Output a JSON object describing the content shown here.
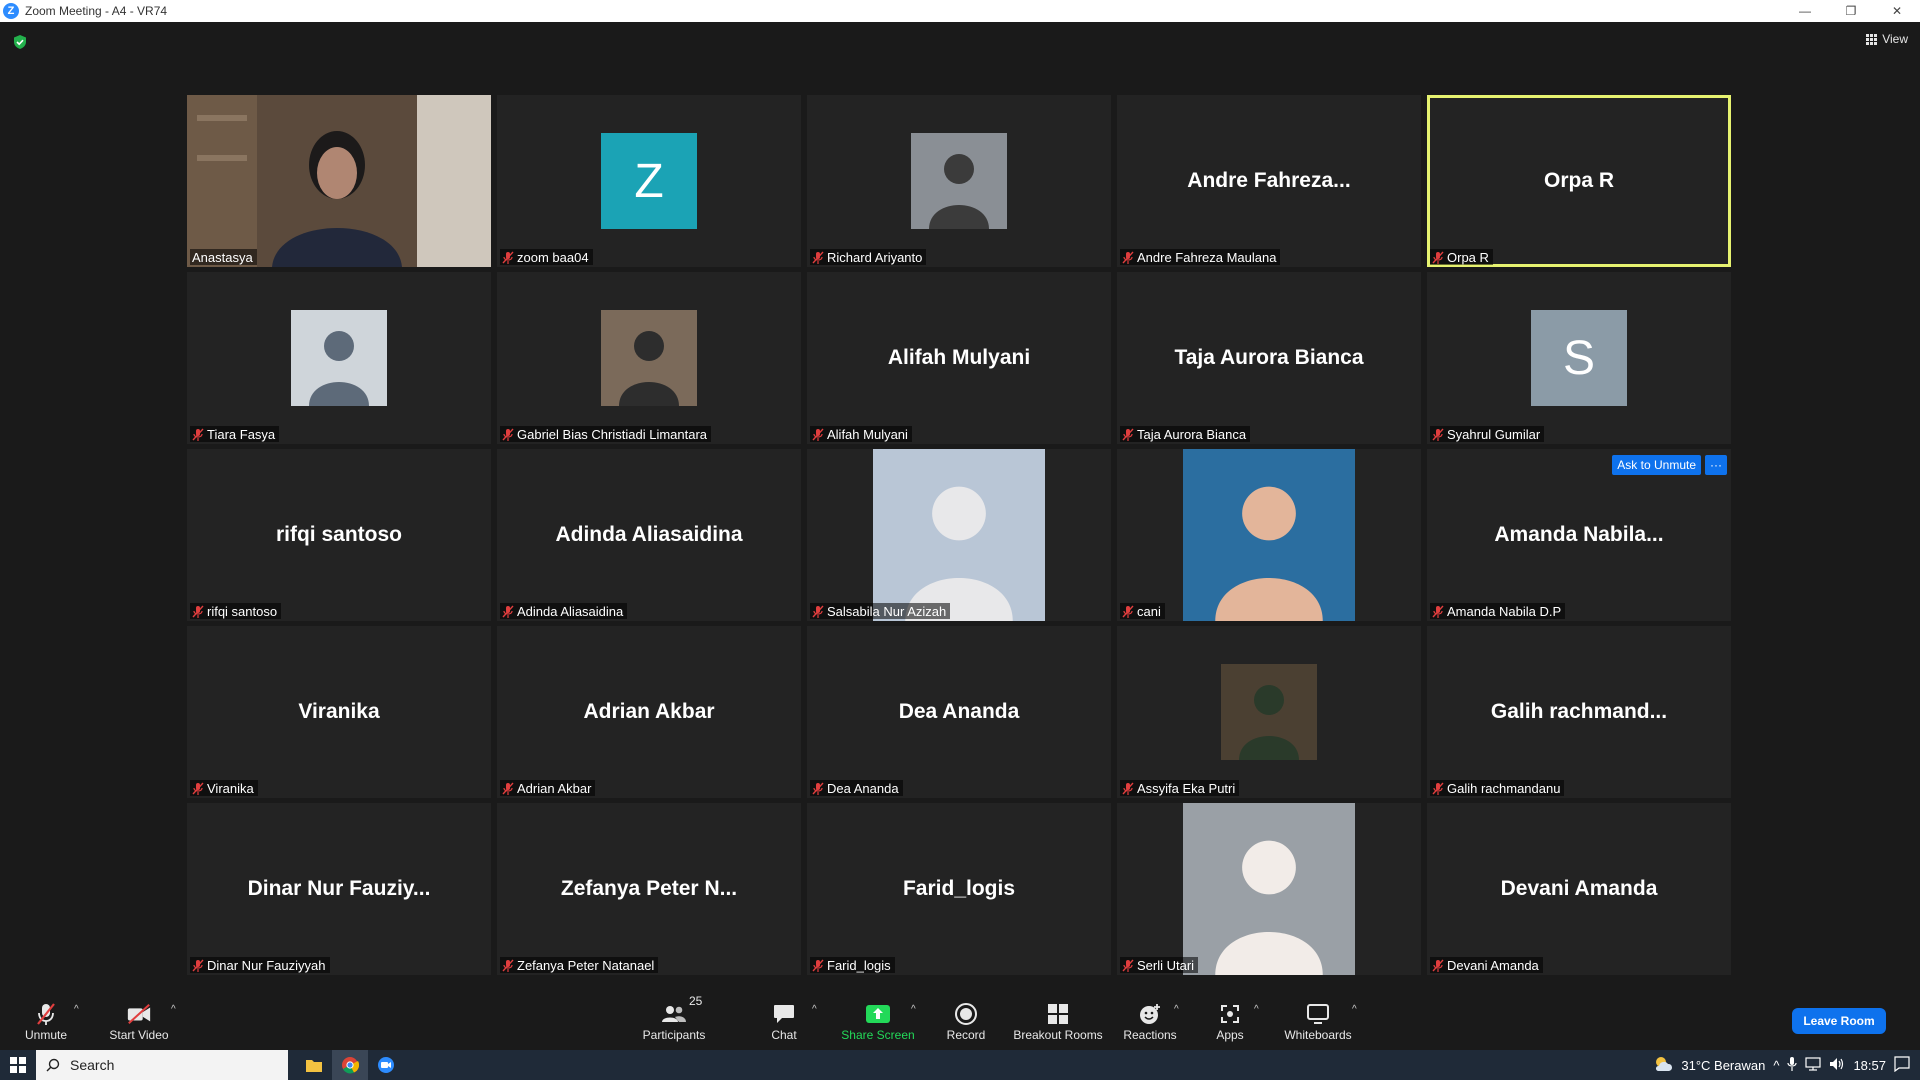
{
  "window": {
    "title": "Zoom Meeting - A4 - VR74",
    "app_logo_letter": "Z"
  },
  "meeting": {
    "view_label": "View",
    "ask_unmute_label": "Ask to Unmute",
    "tile_more_label": "···",
    "active_speaker_color": "#e6f270",
    "participants": [
      {
        "name": "Anastasya",
        "display": "video",
        "muted": false
      },
      {
        "name": "zoom baa04",
        "display": "letter",
        "letter": "Z",
        "color": "#1ba3b5",
        "muted": true
      },
      {
        "name": "Richard Ariyanto",
        "display": "photo",
        "muted": true
      },
      {
        "name": "Andre Fahreza Maulana",
        "display": "text",
        "big": "Andre  Fahreza...",
        "muted": true
      },
      {
        "name": "Orpa R",
        "display": "text",
        "big": "Orpa R",
        "muted": true,
        "active": true
      },
      {
        "name": "Tiara Fasya",
        "display": "photo",
        "muted": true
      },
      {
        "name": "Gabriel Bias Christiadi Limantara",
        "display": "photo",
        "muted": true
      },
      {
        "name": "Alifah Mulyani",
        "display": "text",
        "big": "Alifah Mulyani",
        "muted": true
      },
      {
        "name": "Taja Aurora Bianca",
        "display": "text",
        "big": "Taja Aurora Bianca",
        "muted": true
      },
      {
        "name": "Syahrul Gumilar",
        "display": "letter",
        "letter": "S",
        "color": "#8b9ba7",
        "muted": true
      },
      {
        "name": "rifqi santoso",
        "display": "text",
        "big": "rifqi santoso",
        "muted": true
      },
      {
        "name": "Adinda Aliasaidina",
        "display": "text",
        "big": "Adinda Aliasaidina",
        "muted": true
      },
      {
        "name": "Salsabila Nur Azizah",
        "display": "photo-tall",
        "muted": true
      },
      {
        "name": "cani",
        "display": "photo-tall",
        "muted": true
      },
      {
        "name": "Amanda Nabila D.P",
        "display": "text",
        "big": "Amanda  Nabila...",
        "muted": true,
        "hover": true
      },
      {
        "name": "Viranika",
        "display": "text",
        "big": "Viranika",
        "muted": true
      },
      {
        "name": "Adrian Akbar",
        "display": "text",
        "big": "Adrian Akbar",
        "muted": true
      },
      {
        "name": "Dea Ananda",
        "display": "text",
        "big": "Dea Ananda",
        "muted": true
      },
      {
        "name": "Assyifa Eka Putri",
        "display": "photo",
        "muted": true
      },
      {
        "name": "Galih rachmandanu",
        "display": "text",
        "big": "Galih  rachmand...",
        "muted": true
      },
      {
        "name": "Dinar Nur Fauziyyah",
        "display": "text",
        "big": "Dinar  Nur  Fauziy...",
        "muted": true
      },
      {
        "name": "Zefanya Peter Natanael",
        "display": "text",
        "big": "Zefanya  Peter  N...",
        "muted": true
      },
      {
        "name": "Farid_logis",
        "display": "text",
        "big": "Farid_logis",
        "muted": true
      },
      {
        "name": "Serli Utari",
        "display": "photo-tall",
        "muted": true
      },
      {
        "name": "Devani Amanda",
        "display": "text",
        "big": "Devani Amanda",
        "muted": true
      }
    ]
  },
  "toolbar": {
    "unmute": "Unmute",
    "start_video": "Start Video",
    "participants": "Participants",
    "participants_count": "25",
    "chat": "Chat",
    "share_screen": "Share Screen",
    "record": "Record",
    "breakout_rooms": "Breakout Rooms",
    "reactions": "Reactions",
    "apps": "Apps",
    "whiteboards": "Whiteboards",
    "leave": "Leave Room",
    "share_color": "#23d959",
    "leave_color": "#0e72ed"
  },
  "taskbar": {
    "search_placeholder": "Search",
    "weather": "31°C  Berawan",
    "clock": "18:57"
  }
}
